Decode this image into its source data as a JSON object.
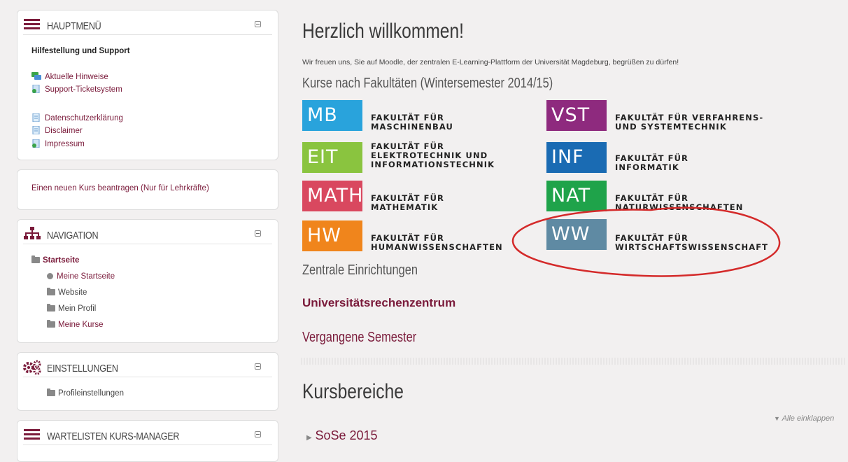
{
  "sidebar": {
    "main_menu": {
      "title": "Hauptmenü",
      "section_heading": "Hilfestellung und Support",
      "items": [
        {
          "label": "Aktuelle Hinweise",
          "icon": "chat-icon"
        },
        {
          "label": "Support-Ticketsystem",
          "icon": "page-icon"
        },
        {
          "label": "Datenschutzerklärung",
          "icon": "document-icon"
        },
        {
          "label": "Disclaimer",
          "icon": "document-icon"
        },
        {
          "label": "Impressum",
          "icon": "page-icon"
        }
      ]
    },
    "request_course": {
      "label": "Einen neuen Kurs beantragen (Nur für Lehrkräfte)"
    },
    "navigation": {
      "title": "Navigation",
      "home": "Startseite",
      "items": [
        {
          "label": "Meine Startseite",
          "icon": "dot-icon",
          "link": true
        },
        {
          "label": "Website",
          "icon": "folder-icon",
          "link": false
        },
        {
          "label": "Mein Profil",
          "icon": "folder-icon",
          "link": false
        },
        {
          "label": "Meine Kurse",
          "icon": "folder-icon",
          "link": true
        }
      ]
    },
    "settings": {
      "title": "Einstellungen",
      "items": [
        {
          "label": "Profileinstellungen",
          "icon": "folder-icon"
        }
      ]
    },
    "waitlist": {
      "title": "Wartelisten Kurs-Manager"
    }
  },
  "main": {
    "welcome_title": "Herzlich willkommen!",
    "welcome_text": "Wir freuen uns, Sie auf Moodle, der zentralen E-Learning-Plattform der Universität Magdeburg, begrüßen zu dürfen!",
    "faculties_heading": "Kurse nach Fakultäten (Wintersemester 2014/15)",
    "faculties": [
      {
        "code": "MB",
        "color": "#29a3dc",
        "lines": [
          "FAKULTÄT FÜR",
          "MASCHINENBAU"
        ]
      },
      {
        "code": "EIT",
        "color": "#8ac43f",
        "lines": [
          "FAKULTÄT FÜR",
          "ELEKTROTECHNIK UND",
          "INFORMATIONSTECHNIK"
        ]
      },
      {
        "code": "MATH",
        "color": "#d9485f",
        "lines": [
          "FAKULTÄT FÜR",
          "MATHEMATIK"
        ]
      },
      {
        "code": "HW",
        "color": "#f0851c",
        "lines": [
          "FAKULTÄT FÜR",
          "HUMANWISSENSCHAFTEN"
        ]
      },
      {
        "code": "VST",
        "color": "#8e2a7e",
        "lines": [
          "FAKULTÄT FÜR VERFAHRENS-",
          "UND SYSTEMTECHNIK"
        ]
      },
      {
        "code": "INF",
        "color": "#1a6bb3",
        "lines": [
          "FAKULTÄT FÜR",
          "INFORMATIK"
        ]
      },
      {
        "code": "NAT",
        "color": "#1fa34a",
        "lines": [
          "FAKULTÄT FÜR",
          "NATURWISSENSCHAFTEN"
        ]
      },
      {
        "code": "WW",
        "color": "#5f8aa3",
        "lines": [
          "FAKULTÄT FÜR",
          "WIRTSCHAFTSWISSENSCHAFT"
        ]
      }
    ],
    "central_heading": "Zentrale Einrichtungen",
    "urz_link": "Universitätsrechenzentrum",
    "past_semesters": "Vergangene Semester",
    "course_areas_heading": "Kursbereiche",
    "collapse_all": "Alle einklappen",
    "course_area_first": "SoSe 2015"
  },
  "colors": {
    "link": "#7a1a3a",
    "annotation": "#d42a2a",
    "background": "#f2f0f0"
  }
}
